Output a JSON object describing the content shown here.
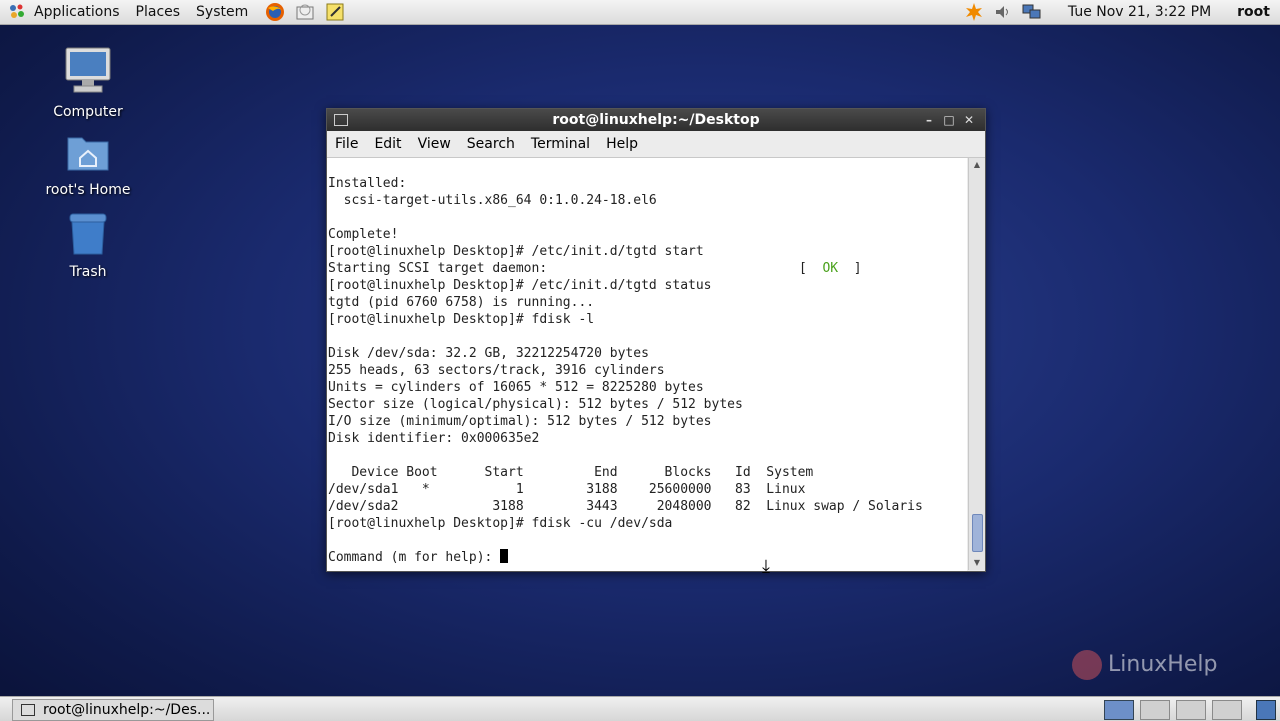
{
  "top_panel": {
    "menu": [
      "Applications",
      "Places",
      "System"
    ],
    "clock": "Tue Nov 21,  3:22 PM",
    "user": "root"
  },
  "desktop_icons": [
    {
      "label": "Computer"
    },
    {
      "label": "root's Home"
    },
    {
      "label": "Trash"
    }
  ],
  "window": {
    "title": "root@linuxhelp:~/Desktop",
    "menu": [
      "File",
      "Edit",
      "View",
      "Search",
      "Terminal",
      "Help"
    ],
    "terminal_lines": [
      "Installed:",
      "  scsi-target-utils.x86_64 0:1.0.24-18.el6",
      "",
      "Complete!",
      "[root@linuxhelp Desktop]# /etc/init.d/tgtd start",
      "Starting SCSI target daemon:",
      "[root@linuxhelp Desktop]# /etc/init.d/tgtd status",
      "tgtd (pid 6760 6758) is running...",
      "[root@linuxhelp Desktop]# fdisk -l",
      "",
      "Disk /dev/sda: 32.2 GB, 32212254720 bytes",
      "255 heads, 63 sectors/track, 3916 cylinders",
      "Units = cylinders of 16065 * 512 = 8225280 bytes",
      "Sector size (logical/physical): 512 bytes / 512 bytes",
      "I/O size (minimum/optimal): 512 bytes / 512 bytes",
      "Disk identifier: 0x000635e2",
      "",
      "   Device Boot      Start         End      Blocks   Id  System",
      "/dev/sda1   *           1        3188    25600000   83  Linux",
      "/dev/sda2            3188        3443     2048000   82  Linux swap / Solaris",
      "[root@linuxhelp Desktop]# fdisk -cu /dev/sda",
      "",
      "Command (m for help): "
    ],
    "ok_status": {
      "open": "[  ",
      "text": "OK",
      "close": "  ]"
    }
  },
  "taskbar": {
    "task_label": "root@linuxhelp:~/Des..."
  },
  "watermark": "LinuxHelp"
}
